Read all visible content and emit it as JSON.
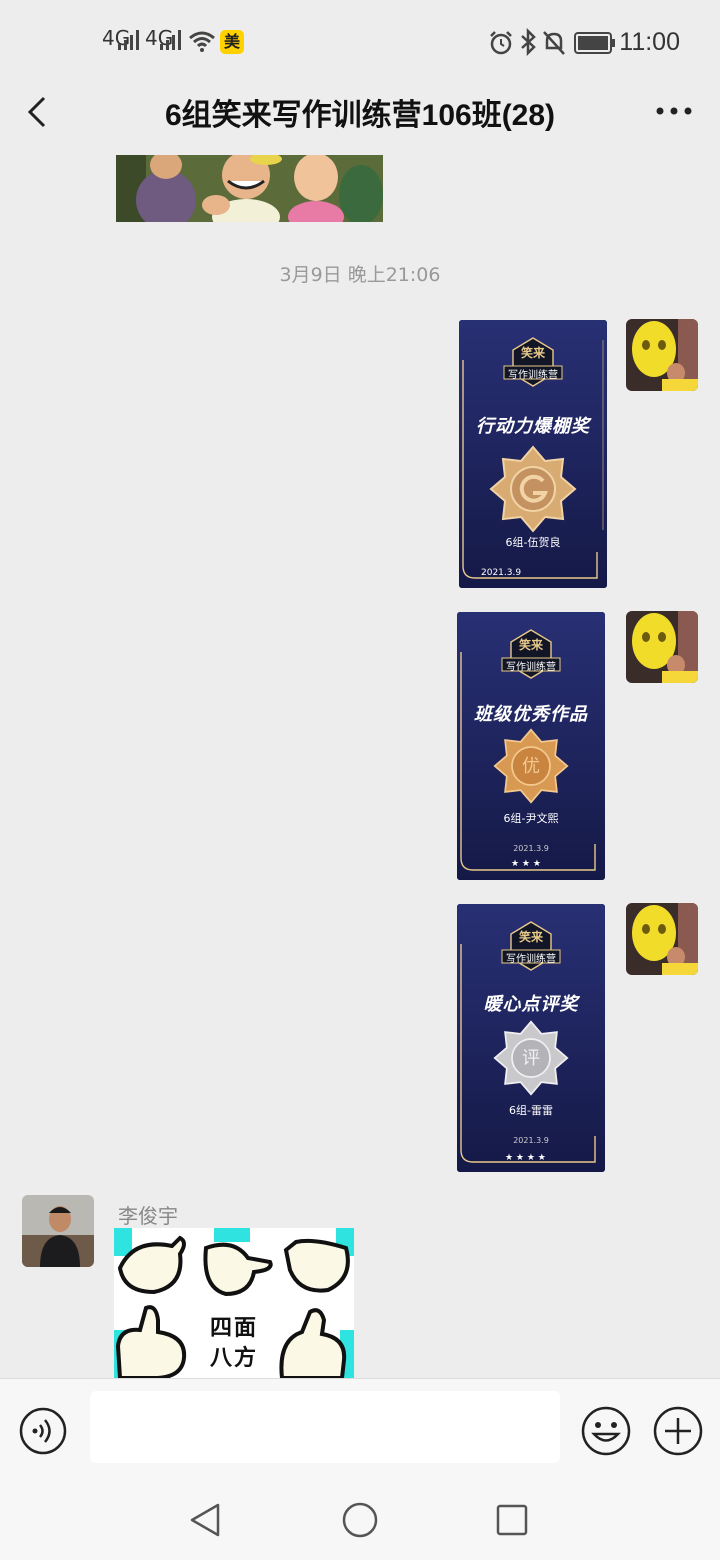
{
  "status_bar": {
    "signal_1": "4G",
    "signal_2": "4G",
    "app_badge": "美",
    "time": "11:00"
  },
  "header": {
    "title": "6组笑来写作训练营106班(28)"
  },
  "chat": {
    "timestamp": "3月9日 晚上21:06",
    "certificates": [
      {
        "logo_top": "笑来",
        "logo_name": "写作训练营",
        "award": "行动力爆棚奖",
        "medal_char": "",
        "recipient": "6组-伍贺良",
        "date": "2021.3.9",
        "medal_color": "#c89a62"
      },
      {
        "logo_top": "笑来",
        "logo_name": "写作训练营",
        "award": "班级优秀作品",
        "medal_char": "优",
        "recipient": "6组-尹文熙",
        "date": "2021.3.9",
        "medal_color": "#d69a52"
      },
      {
        "logo_top": "笑来",
        "logo_name": "写作训练营",
        "award": "暖心点评奖",
        "medal_char": "评",
        "recipient": "6组-雷雷",
        "date": "2021.3.9",
        "medal_color": "#c9c9cc"
      }
    ],
    "sender_name": "李俊宇",
    "sticker_text_1": "四面",
    "sticker_text_2": "八方"
  },
  "colors": {
    "background": "#ededed",
    "card_bg": "#1f2458",
    "gold": "#e8c98a",
    "sticker_cyan": "#2fe4e0"
  }
}
